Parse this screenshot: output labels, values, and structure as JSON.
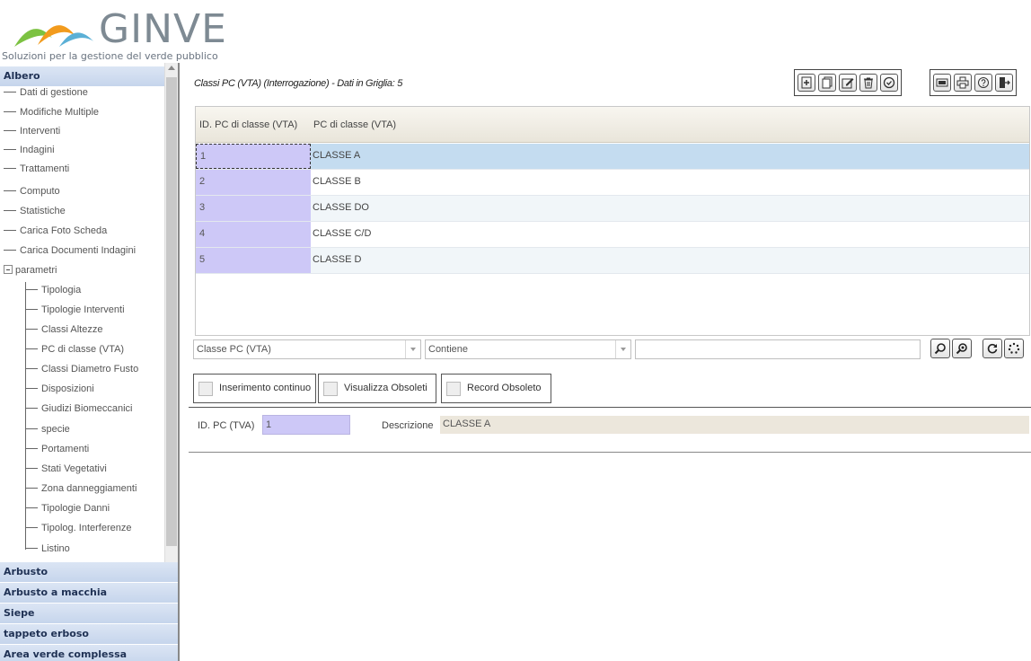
{
  "app": {
    "brand": "GINVE",
    "tagline": "Soluzioni per la gestione del verde pubblico"
  },
  "sidebar": {
    "sections": [
      {
        "label": "Albero"
      },
      {
        "label": "Arbusto"
      },
      {
        "label": "Arbusto a macchia"
      },
      {
        "label": "Siepe"
      },
      {
        "label": "tappeto erboso"
      },
      {
        "label": "Area verde complessa"
      }
    ],
    "tree": [
      "Dati di gestione",
      "Modifiche Multiple",
      "Interventi",
      "Indagini",
      "Trattamenti",
      "Computo",
      "Statistiche",
      "Carica Foto Scheda",
      "Carica Documenti Indagini"
    ],
    "parametri": {
      "label": "parametri",
      "children": [
        "Tipologia",
        "Tipologie Interventi",
        "Classi Altezze",
        "PC di classe (VTA)",
        "Classi Diametro Fusto",
        "Disposizioni",
        "Giudizi Biomeccanici",
        "specie",
        "Portamenti",
        "Stati Vegetativi",
        "Zona danneggiamenti",
        "Tipologie Danni",
        "Tipolog. Interferenze",
        "Listino"
      ]
    }
  },
  "form": {
    "title": "Classi PC (VTA) (Interrogazione) - Dati in Griglia: 5"
  },
  "toolbar": {
    "group1": [
      "new-record-icon",
      "copy-record-icon",
      "edit-record-icon",
      "delete-record-icon",
      "confirm-icon"
    ],
    "group2": [
      "export-icon",
      "print-icon",
      "help-icon",
      "exit-icon"
    ]
  },
  "grid": {
    "columns": [
      "ID. PC di classe (VTA)",
      "PC di classe (VTA)"
    ],
    "rows": [
      {
        "id": "1",
        "desc": "CLASSE A"
      },
      {
        "id": "2",
        "desc": "CLASSE B"
      },
      {
        "id": "3",
        "desc": "CLASSE DO"
      },
      {
        "id": "4",
        "desc": "CLASSE C/D"
      },
      {
        "id": "5",
        "desc": "CLASSE D"
      }
    ],
    "selected_row": 1
  },
  "filter": {
    "field": "Classe PC (VTA)",
    "operator": "Contiene",
    "value": ""
  },
  "options": {
    "continuous_insert": "Inserimento continuo",
    "show_obsolete": "Visualizza Obsoleti",
    "record_obsolete": "Record Obsoleto"
  },
  "detail": {
    "id_label": "ID. PC (TVA)",
    "id_value": "1",
    "desc_label": "Descrizione",
    "desc_value": "CLASSE A"
  },
  "colors": {
    "accent_id_cell": "#cdc8f7",
    "selected_row": "#c4dcf0",
    "sidebar_header": "#c6d5ec",
    "logo_orange": "#f29b1d",
    "logo_green": "#7cc242"
  }
}
